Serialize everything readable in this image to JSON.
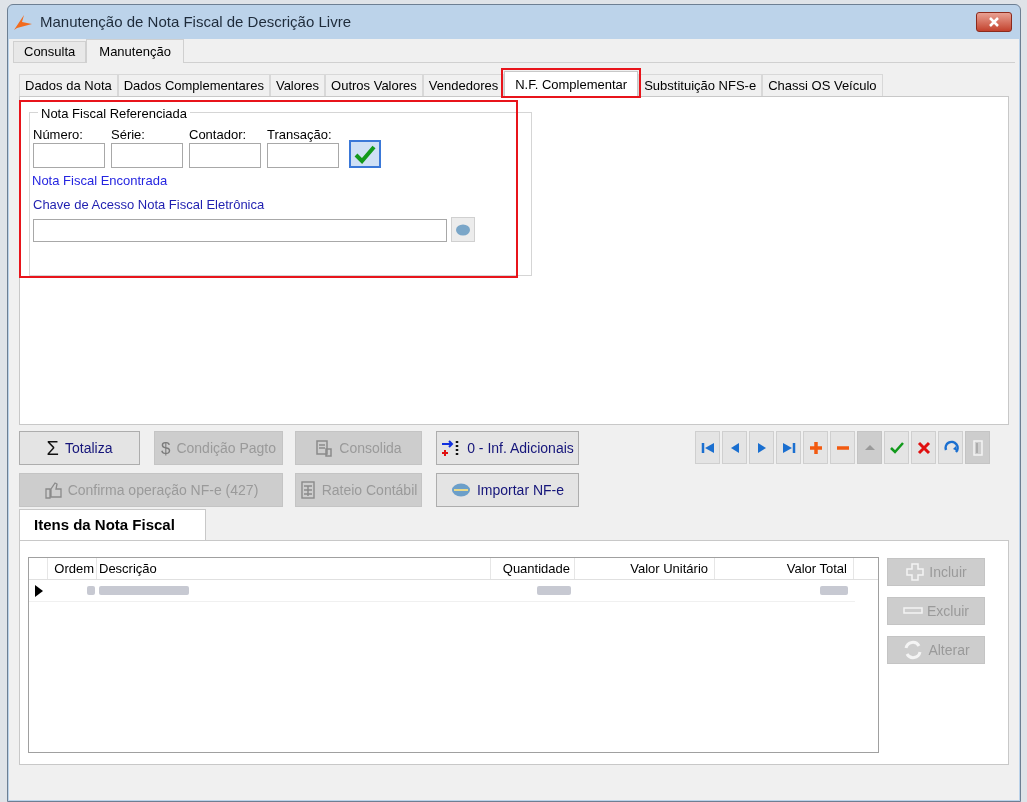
{
  "window": {
    "title": "Manutenção de Nota Fiscal de Descrição Livre"
  },
  "main_tabs": [
    {
      "label": "Consulta",
      "selected": false
    },
    {
      "label": "Manutenção",
      "selected": true
    }
  ],
  "tabs": [
    {
      "label": "Dados da Nota",
      "selected": false,
      "highlighted": false
    },
    {
      "label": "Dados Complementares",
      "selected": false,
      "highlighted": false
    },
    {
      "label": "Valores",
      "selected": false,
      "highlighted": false
    },
    {
      "label": "Outros Valores",
      "selected": false,
      "highlighted": false
    },
    {
      "label": "Vendedores",
      "selected": false,
      "highlighted": false
    },
    {
      "label": "N.F. Complementar",
      "selected": true,
      "highlighted": true
    },
    {
      "label": "Substituição NFS-e",
      "selected": false,
      "highlighted": false
    },
    {
      "label": "Chassi OS Veículo",
      "selected": false,
      "highlighted": false
    }
  ],
  "referenced_invoice": {
    "title": "Nota Fiscal Referenciada",
    "highlighted": true,
    "fields": [
      {
        "label": "Número:"
      },
      {
        "label": "Série:"
      },
      {
        "label": "Contador:"
      },
      {
        "label": "Transação:"
      }
    ],
    "status": "Nota Fiscal Encontrada",
    "access_key_label": "Chave de Acesso Nota Fiscal Eletrônica"
  },
  "action_buttons": [
    {
      "label": "Totaliza",
      "symbol": "Σ",
      "kind": "sigma",
      "disabled": false
    },
    {
      "label": "Condição Pagto",
      "symbol": "$",
      "kind": "dollar",
      "disabled": true
    },
    {
      "label": "Consolida",
      "kind": "document",
      "disabled": true
    },
    {
      "label": "0 - Inf. Adicionais",
      "kind": "arrows",
      "disabled": false
    },
    {
      "label": "Confirma operação NF-e (427)",
      "kind": "thumb",
      "disabled": true
    },
    {
      "label": "Rateio Contábil",
      "kind": "sheet",
      "disabled": true
    },
    {
      "label": "Importar NF-e",
      "kind": "import",
      "disabled": false
    }
  ],
  "navigator": [
    {
      "kind": "first",
      "disabled": false
    },
    {
      "kind": "prior",
      "disabled": false
    },
    {
      "kind": "next",
      "disabled": false
    },
    {
      "kind": "last",
      "disabled": false
    },
    {
      "kind": "insert",
      "disabled": false
    },
    {
      "kind": "delete",
      "disabled": false
    },
    {
      "kind": "edit",
      "disabled": true
    },
    {
      "kind": "post",
      "disabled": false
    },
    {
      "kind": "cancel",
      "disabled": false
    },
    {
      "kind": "refresh",
      "disabled": false
    },
    {
      "kind": "apply",
      "disabled": true
    }
  ],
  "items_tab": {
    "label": "Itens da Nota Fiscal"
  },
  "table": {
    "columns": [
      "Ordem",
      "Descrição",
      "Quantidade",
      "Valor Unitário",
      "Valor Total"
    ],
    "rows": [
      {
        "selected": true
      }
    ]
  },
  "item_buttons": [
    {
      "label": "Incluir",
      "kind": "plus",
      "disabled": true
    },
    {
      "label": "Excluir",
      "kind": "minus",
      "disabled": true
    },
    {
      "label": "Alterar",
      "kind": "cycle",
      "disabled": true
    }
  ]
}
